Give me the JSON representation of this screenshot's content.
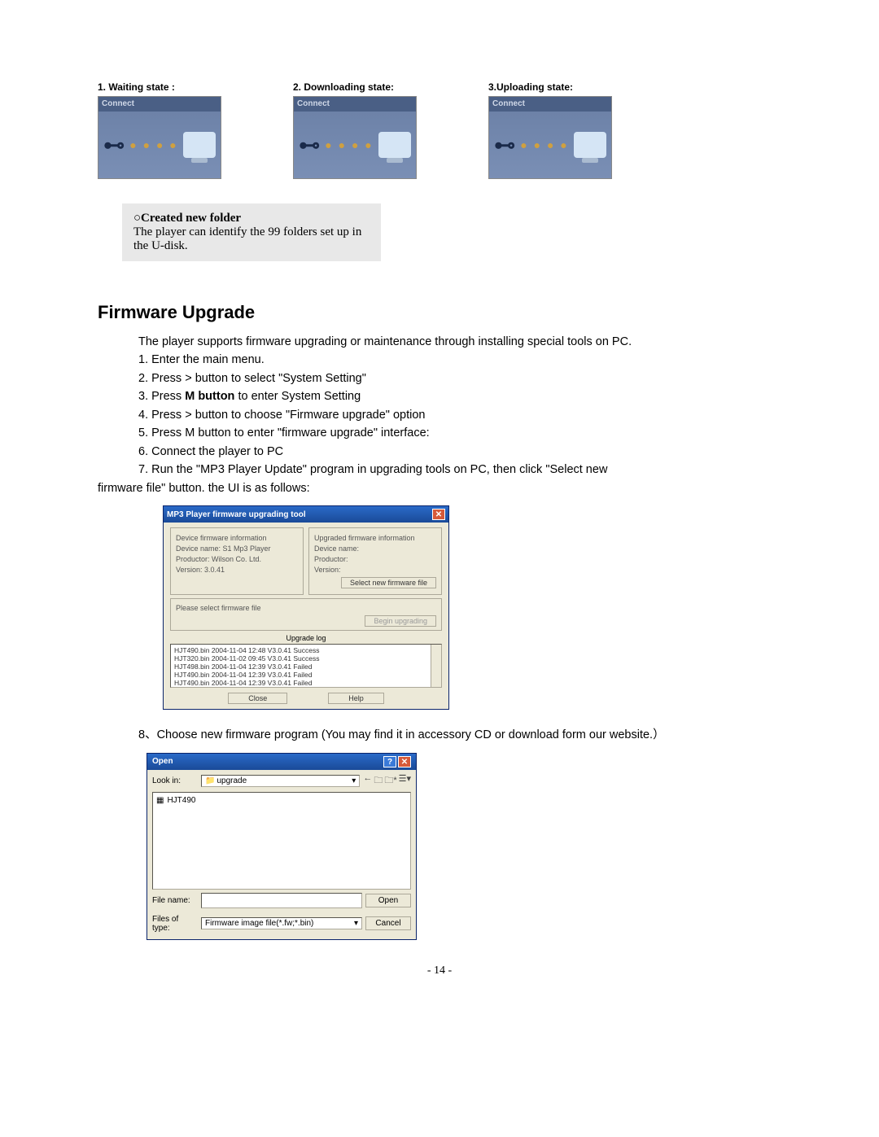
{
  "states": [
    {
      "label": "1. Waiting state :",
      "banner": "Connect"
    },
    {
      "label": "2. Downloading state:",
      "banner": "Connect"
    },
    {
      "label": "3.Uploading state:",
      "banner": "Connect"
    }
  ],
  "note": {
    "title": "○Created new folder",
    "body": "The player can identify the 99 folders set up in the U-disk."
  },
  "section_heading": "Firmware Upgrade",
  "intro": "The player supports firmware upgrading or maintenance through installing special tools on PC.",
  "steps": {
    "s1": "1. Enter the main menu.",
    "s2": "2. Press > button to select \"System Setting\"",
    "s3_pre": "3. Press ",
    "s3_bold": "M button",
    "s3_post": " to enter System Setting",
    "s4": "4. Press > button to choose \"Firmware upgrade\" option",
    "s5": "5. Press M button to enter \"firmware upgrade\" interface:",
    "s6": " 6. Connect the player to PC",
    "s7a": " 7. Run the \"MP3 Player Update\" program in upgrading tools on PC, then click \"Select new",
    "s7b": "firmware file\"      button. the UI is as follows:"
  },
  "dialog1": {
    "title": "MP3 Player firmware upgrading tool",
    "left_frame_title": "Device firmware information",
    "left": {
      "l1": "Device name: S1 Mp3 Player",
      "l2": "Productor: Wilson Co. Ltd.",
      "l3": "Version: 3.0.41"
    },
    "right_frame_title": "Upgraded firmware information",
    "right": {
      "r1": "Device name:",
      "r2": "Productor:",
      "r3": "Version:"
    },
    "select_btn": "Select new firmware file",
    "please_select": "Please select firmware file",
    "begin_btn": "Begin upgrading",
    "log_label": "Upgrade log",
    "log": [
      "HJT490.bin  2004-11-04  12:48  V3.0.41  Success",
      "HJT320.bin  2004-11-02  09:45  V3.0.41  Success",
      "HJT498.bin  2004-11-04  12:39  V3.0.41  Failed",
      "HJT490.bin  2004-11-04  12:39  V3.0.41  Failed",
      "HJT490.bin  2004-11-04  12:39  V3.0.41  Failed"
    ],
    "close_btn": "Close",
    "help_btn": "Help"
  },
  "step8": "8、Choose new firmware program (You may find it in accessory CD or download form our website.）",
  "dialog2": {
    "title": "Open",
    "lookin_label": "Look in:",
    "lookin_value": "upgrade",
    "file_item": "HJT490",
    "filename_label": "File name:",
    "filename_value": "",
    "filetype_label": "Files of type:",
    "filetype_value": "Firmware image file(*.fw;*.bin)",
    "open_btn": "Open",
    "cancel_btn": "Cancel"
  },
  "page_number": "- 14 -"
}
